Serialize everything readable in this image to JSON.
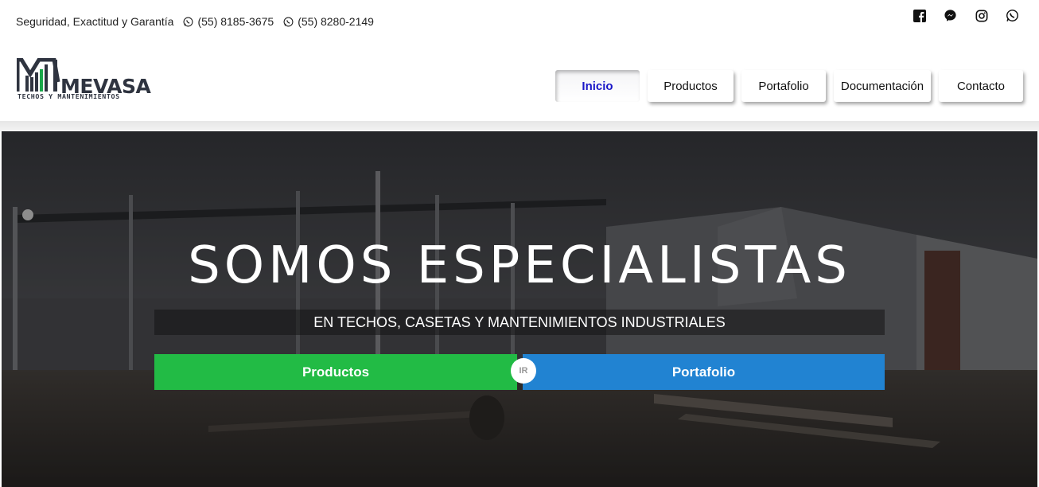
{
  "topbar": {
    "tagline": "Seguridad, Exactitud y Garantía",
    "phone_1": "(55) 8185-3675",
    "phone_2": "(55) 8280-2149",
    "socials": [
      "facebook-icon",
      "messenger-icon",
      "instagram-icon",
      "whatsapp-icon"
    ]
  },
  "logo": {
    "word": "MEVASA",
    "subtitle": "TECHOS Y MANTENIMIENTOS"
  },
  "nav": {
    "items": [
      {
        "label": "Inicio",
        "active": true
      },
      {
        "label": "Productos",
        "active": false
      },
      {
        "label": "Portafolio",
        "active": false
      },
      {
        "label": "Documentación",
        "active": false
      },
      {
        "label": "Contacto",
        "active": false
      }
    ]
  },
  "hero": {
    "title": "SOMOS ESPECIALISTAS",
    "subtitle": "EN TECHOS, CASETAS Y MANTENIMIENTOS INDUSTRIALES",
    "button_left": "Productos",
    "button_right": "Portafolio",
    "divider_badge": "IR"
  },
  "colors": {
    "green": "#22bb45",
    "blue": "#2183d2",
    "active_nav": "#1a17c8"
  }
}
